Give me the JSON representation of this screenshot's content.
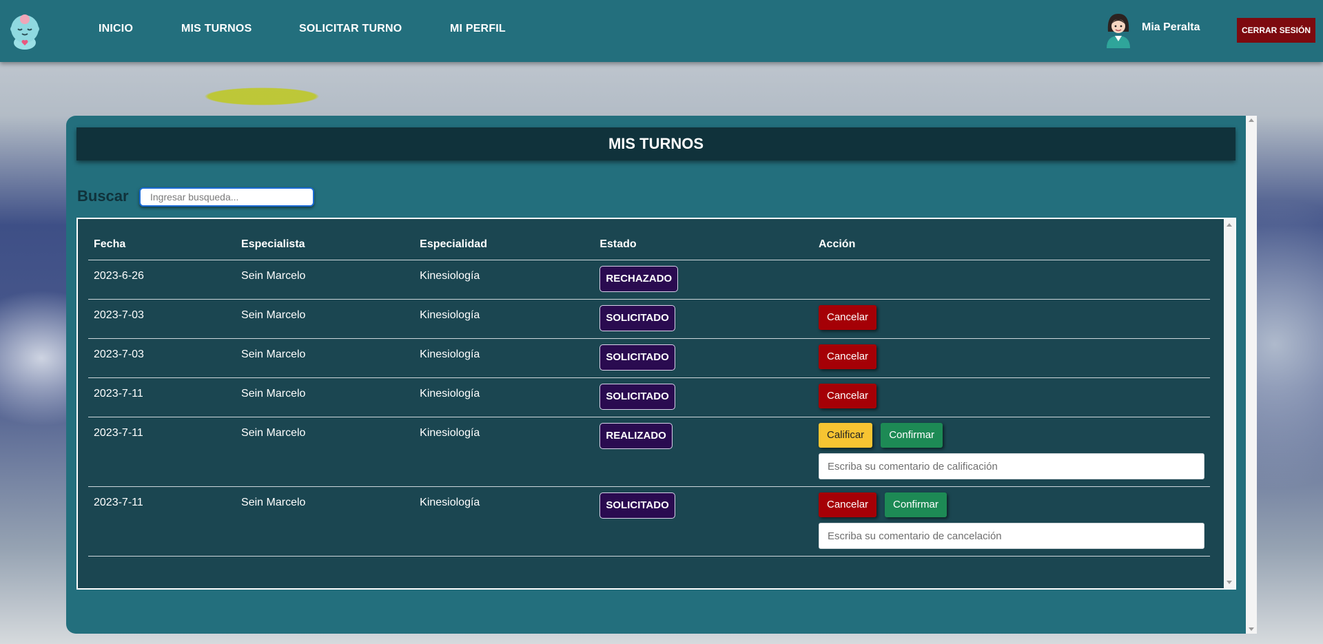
{
  "nav": {
    "links": [
      "INICIO",
      "MIS TURNOS",
      "SOLICITAR TURNO",
      "MI PERFIL"
    ],
    "user_name": "Mia Peralta",
    "logout_label": "CERRAR SESIÓN"
  },
  "page": {
    "title": "MIS TURNOS",
    "search_label": "Buscar",
    "search_placeholder": "Ingresar busqueda..."
  },
  "table": {
    "headers": [
      "Fecha",
      "Especialista",
      "Especialidad",
      "Estado",
      "Acción"
    ],
    "rows": [
      {
        "fecha": "2023-6-26",
        "especialista": "Sein Marcelo",
        "especialidad": "Kinesiología",
        "estado": "RECHAZADO"
      },
      {
        "fecha": "2023-7-03",
        "especialista": "Sein Marcelo",
        "especialidad": "Kinesiología",
        "estado": "SOLICITADO",
        "cancel_label": "Cancelar"
      },
      {
        "fecha": "2023-7-03",
        "especialista": "Sein Marcelo",
        "especialidad": "Kinesiología",
        "estado": "SOLICITADO",
        "cancel_label": "Cancelar"
      },
      {
        "fecha": "2023-7-11",
        "especialista": "Sein Marcelo",
        "especialidad": "Kinesiología",
        "estado": "SOLICITADO",
        "cancel_label": "Cancelar"
      },
      {
        "fecha": "2023-7-11",
        "especialista": "Sein Marcelo",
        "especialidad": "Kinesiología",
        "estado": "REALIZADO",
        "rate_label": "Calificar",
        "confirm_label": "Confirmar",
        "comment_placeholder": "Escriba su comentario de calificación"
      },
      {
        "fecha": "2023-7-11",
        "especialista": "Sein Marcelo",
        "especialidad": "Kinesiología",
        "estado": "SOLICITADO",
        "cancel_label": "Cancelar",
        "confirm_label": "Confirmar",
        "comment_placeholder": "Escriba su comentario de cancelación"
      }
    ]
  },
  "colors": {
    "navbar": "#236f7d",
    "panel": "#236f7d",
    "title_bar": "#10323b",
    "table_bg": "#1b4651",
    "status_badge": "#2a0b50",
    "cancel": "#a50006",
    "rate": "#f7c432",
    "confirm": "#1d8a55",
    "logout": "#7d0a0f"
  },
  "icons": {
    "logo": "baby-face-logo-icon",
    "user": "user-avatar-icon"
  }
}
